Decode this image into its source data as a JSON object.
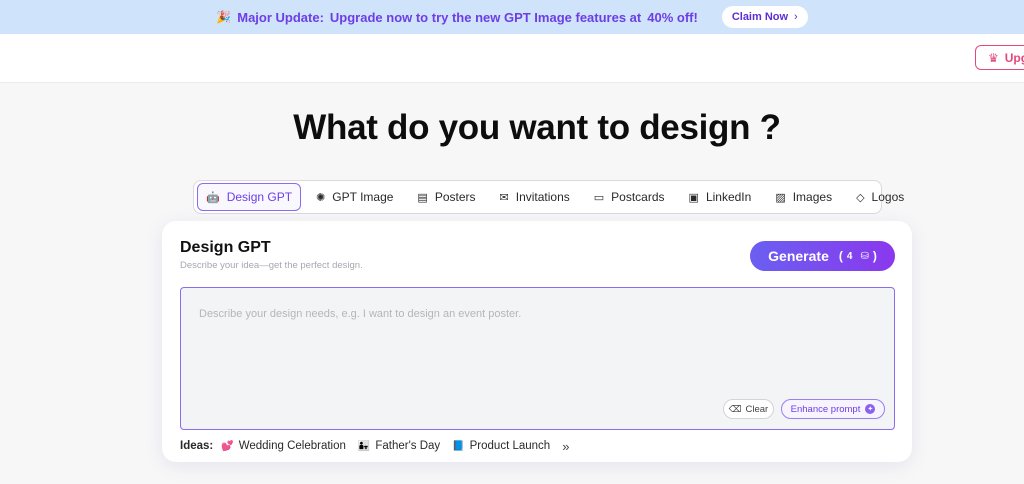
{
  "banner": {
    "prefix": "Major Update:",
    "message": "Upgrade now to try the new GPT Image features at",
    "discount": "40% off!",
    "claim_label": "Claim Now",
    "accent_color": "#6d3ee6"
  },
  "header": {
    "upgrade_label": "Upg"
  },
  "main": {
    "title": "What do you want to design ?",
    "tabs": [
      {
        "label": "Design GPT",
        "icon": "robot-icon",
        "active": true
      },
      {
        "label": "GPT Image",
        "icon": "openai-icon"
      },
      {
        "label": "Posters",
        "icon": "poster-icon"
      },
      {
        "label": "Invitations",
        "icon": "invitation-icon"
      },
      {
        "label": "Postcards",
        "icon": "postcard-icon"
      },
      {
        "label": "LinkedIn",
        "icon": "linkedin-icon"
      },
      {
        "label": "Images",
        "icon": "image-icon"
      },
      {
        "label": "Logos",
        "icon": "diamond-icon"
      }
    ]
  },
  "card": {
    "title": "Design GPT",
    "subtitle": "Describe your idea—get the perfect design.",
    "generate_label": "Generate",
    "cost": "4",
    "placeholder": "Describe your design needs, e.g. I want to design an event poster.",
    "clear_label": "Clear",
    "enhance_label": "Enhance prompt",
    "ideas_label": "Ideas:",
    "ideas": [
      {
        "label": "Wedding Celebration",
        "icon": "hearts-icon"
      },
      {
        "label": "Father's Day",
        "icon": "father-child-icon"
      },
      {
        "label": "Product Launch",
        "icon": "book-icon"
      }
    ]
  }
}
